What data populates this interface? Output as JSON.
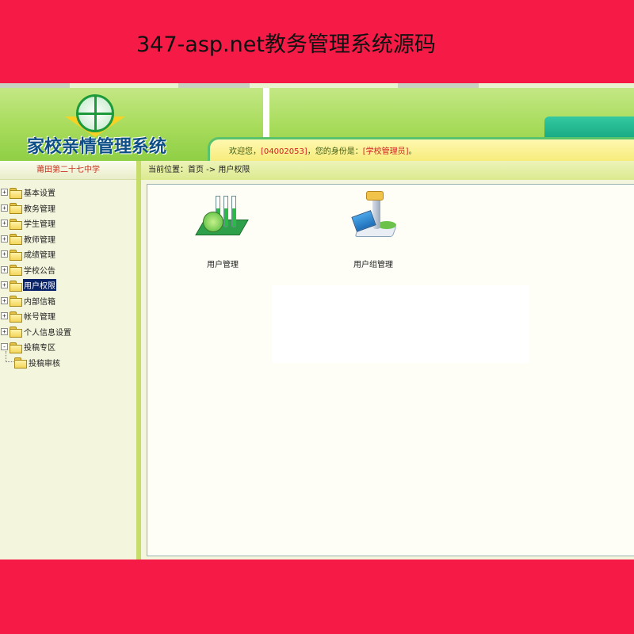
{
  "banner": {
    "title": "347-asp.net教务管理系统源码"
  },
  "header": {
    "logo_text": "家校亲情管理系统",
    "welcome_prefix": "欢迎您，",
    "user_id": "[04002053]",
    "welcome_mid": "，您的身份是：",
    "role": "[学校管理员]",
    "welcome_suffix": "。"
  },
  "sidebar": {
    "school": "莆田第二十七中学",
    "items": [
      {
        "expander": "+",
        "label": "基本设置"
      },
      {
        "expander": "+",
        "label": "教务管理"
      },
      {
        "expander": "+",
        "label": "学生管理"
      },
      {
        "expander": "+",
        "label": "教师管理"
      },
      {
        "expander": "+",
        "label": "成绩管理"
      },
      {
        "expander": "+",
        "label": "学校公告"
      },
      {
        "expander": "+",
        "label": "用户权限",
        "selected": true
      },
      {
        "expander": "+",
        "label": "内部信箱"
      },
      {
        "expander": "+",
        "label": "帐号管理"
      },
      {
        "expander": "+",
        "label": "个人信息设置"
      },
      {
        "expander": "-",
        "label": "投稿专区"
      }
    ],
    "child_items": [
      {
        "label": "投稿审核"
      }
    ]
  },
  "breadcrumb": "当前位置：首页 -> 用户权限",
  "tiles": [
    {
      "label": "用户管理",
      "icon": "flask-icon"
    },
    {
      "label": "用户组管理",
      "icon": "microscope-icon"
    }
  ],
  "colors": {
    "banner": "#f51b46",
    "header_green": "#a8dc5c",
    "selected_bg": "#0a246a",
    "school_text": "#c8321f"
  }
}
